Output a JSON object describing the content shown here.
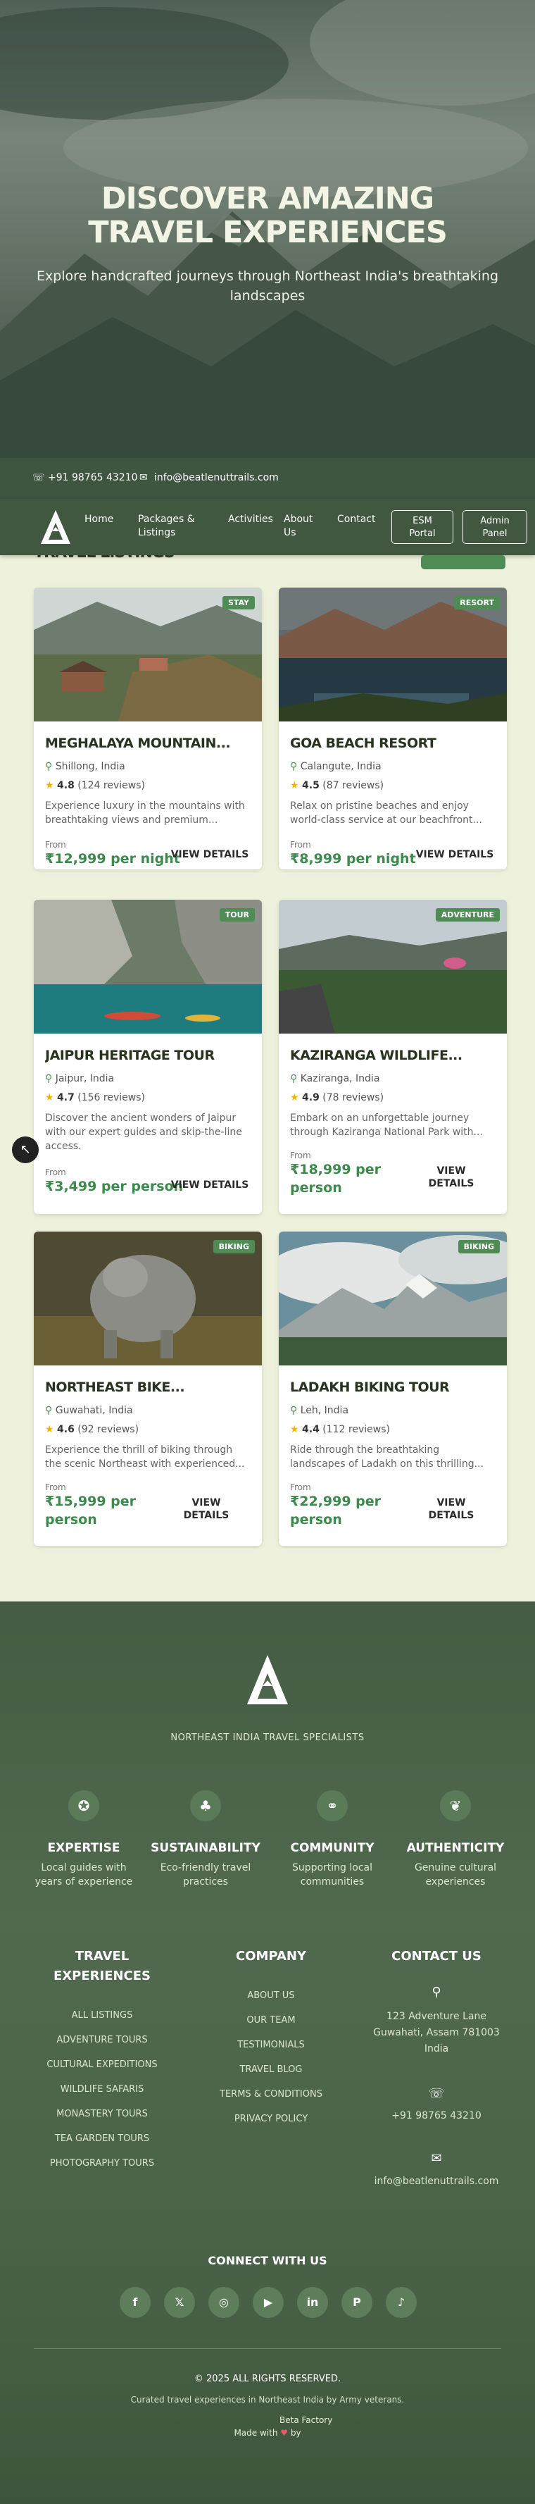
{
  "hero": {
    "title_line1": "DISCOVER AMAZING",
    "title_line2": "TRAVEL EXPERIENCES",
    "subtitle": "Explore handcrafted journeys through Northeast India's breathtaking landscapes"
  },
  "topbar": {
    "phone": "+91 98765 43210",
    "email": "info@beatlenuttrails.com"
  },
  "nav": {
    "logo_icon": "mountain-logo",
    "links": [
      {
        "line1": "Home",
        "line2": ""
      },
      {
        "line1": "Packages &",
        "line2": "Listings"
      },
      {
        "line1": "Activities",
        "line2": ""
      },
      {
        "line1": "About",
        "line2": "Us"
      },
      {
        "line1": "Contact",
        "line2": ""
      }
    ],
    "buttons": [
      {
        "line1": "ESM",
        "line2": "Portal"
      },
      {
        "line1": "Admin",
        "line2": "Panel"
      }
    ]
  },
  "listings": {
    "section_title": "TRAVEL LISTINGS",
    "from_label": "From",
    "cards": [
      {
        "badge": "STAY",
        "title": "MEGHALAYA MOUNTAIN...",
        "location": "Shillong, India",
        "rating": "4.8",
        "reviews": "(124 reviews)",
        "description": "Experience luxury in the mountains with breathtaking views and premium...",
        "price": "₹12,999 per night",
        "action": "VIEW DETAILS"
      },
      {
        "badge": "RESORT",
        "title": "GOA BEACH RESORT",
        "location": "Calangute, India",
        "rating": "4.5",
        "reviews": "(87 reviews)",
        "description": "Relax on pristine beaches and enjoy world-class service at our beachfront...",
        "price": "₹8,999 per night",
        "action": "VIEW DETAILS"
      },
      {
        "badge": "TOUR",
        "title": "JAIPUR HERITAGE TOUR",
        "location": "Jaipur, India",
        "rating": "4.7",
        "reviews": "(156 reviews)",
        "description": "Discover the ancient wonders of Jaipur with our expert guides and skip-the-line access.",
        "price": "₹3,499 per person",
        "action": "VIEW DETAILS"
      },
      {
        "badge": "ADVENTURE",
        "title": "KAZIRANGA WILDLIFE...",
        "location": "Kaziranga, India",
        "rating": "4.9",
        "reviews": "(78 reviews)",
        "description": "Embark on an unforgettable journey through Kaziranga National Park with...",
        "price_line1": "₹18,999 per",
        "price_line2": "person",
        "action_line1": "VIEW",
        "action_line2": "DETAILS"
      },
      {
        "badge": "BIKING",
        "title": "NORTHEAST BIKE...",
        "location": "Guwahati, India",
        "rating": "4.6",
        "reviews": "(92 reviews)",
        "description": "Experience the thrill of biking through the scenic Northeast with experienced...",
        "price_line1": "₹15,999 per",
        "price_line2": "person",
        "action_line1": "VIEW",
        "action_line2": "DETAILS"
      },
      {
        "badge": "BIKING",
        "title": "LADAKH BIKING TOUR",
        "location": "Leh, India",
        "rating": "4.4",
        "reviews": "(112 reviews)",
        "description": "Ride through the breathtaking landscapes of Ladakh on this thrilling...",
        "price_line1": "₹22,999 per",
        "price_line2": "person",
        "action_line1": "VIEW",
        "action_line2": "DETAILS"
      }
    ]
  },
  "footer": {
    "tagline": "NORTHEAST INDIA TRAVEL SPECIALISTS",
    "features": [
      {
        "icon": "compass-icon",
        "title": "EXPERTISE",
        "text_line1": "Local guides with",
        "text_line2": "years of experience"
      },
      {
        "icon": "tree-icon",
        "title": "SUSTAINABILITY",
        "text_line1": "Eco-friendly travel",
        "text_line2": "practices"
      },
      {
        "icon": "handshake-icon",
        "title": "COMMUNITY",
        "text_line1": "Supporting local",
        "text_line2": "communities"
      },
      {
        "icon": "leaf-icon",
        "title": "AUTHENTICITY",
        "text_line1": "Genuine cultural",
        "text_line2": "experiences"
      }
    ],
    "travel": {
      "heading_line1": "TRAVEL",
      "heading_line2": "EXPERIENCES",
      "links": [
        "ALL LISTINGS",
        "ADVENTURE TOURS",
        "CULTURAL EXPEDITIONS",
        "WILDLIFE SAFARIS",
        "MONASTERY TOURS",
        "TEA GARDEN TOURS",
        "PHOTOGRAPHY TOURS"
      ]
    },
    "company": {
      "heading": "COMPANY",
      "links": [
        "ABOUT US",
        "OUR TEAM",
        "TESTIMONIALS",
        "TRAVEL BLOG",
        "TERMS & CONDITIONS",
        "PRIVACY POLICY"
      ]
    },
    "contact": {
      "heading": "CONTACT US",
      "address_line1": "123 Adventure Lane",
      "address_line2": "Guwahati, Assam 781003",
      "address_line3": "India",
      "phone": "+91 98765 43210",
      "email": "info@beatlenuttrails.com"
    },
    "connect_heading": "CONNECT WITH US",
    "socials": [
      "facebook-icon",
      "twitter-icon",
      "instagram-icon",
      "youtube-icon",
      "linkedin-icon",
      "pinterest-icon",
      "tiktok-icon"
    ],
    "copyright": "© 2025 ALL RIGHTS RESERVED.",
    "sub_copyright": "Curated travel experiences in Northeast India by Army veterans.",
    "made_with": "Made with",
    "made_by": "by",
    "maker": "Beta Factory"
  },
  "colors": {
    "accent_green": "#4f8c55",
    "price_green": "#3c8a4c",
    "footer_green": "#4a6348",
    "nav_green": "#41573f"
  }
}
